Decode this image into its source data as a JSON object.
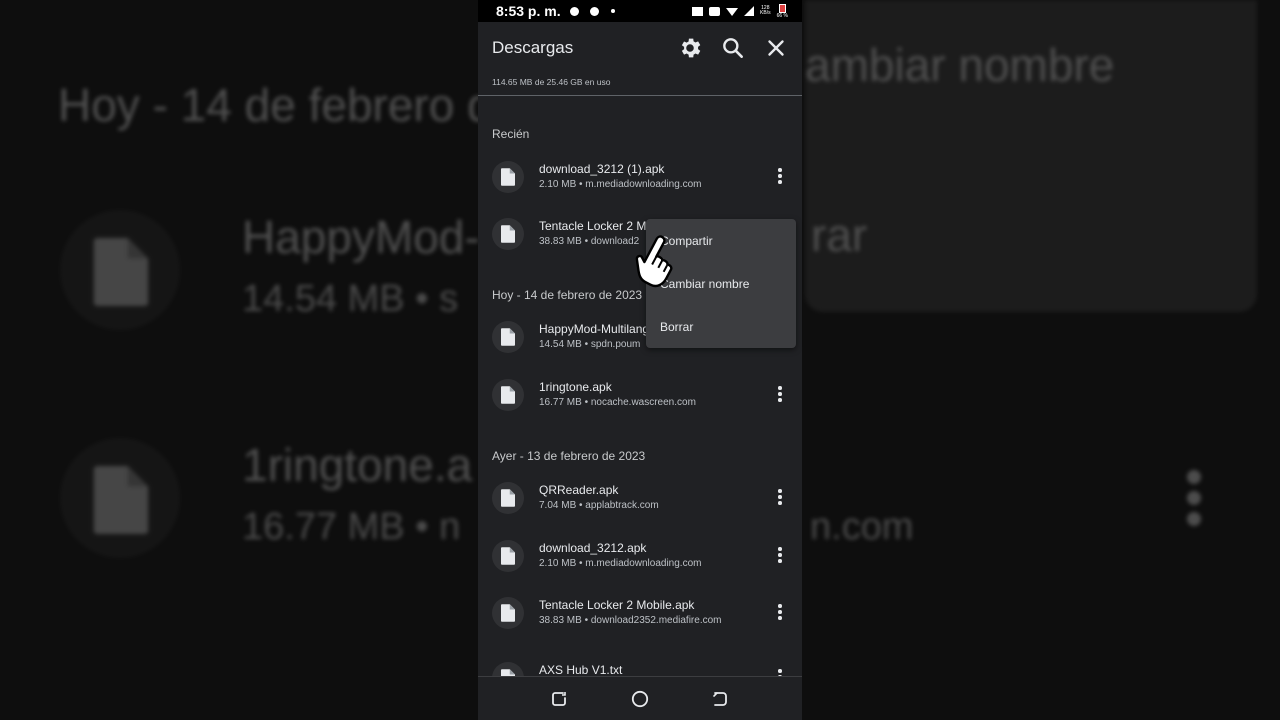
{
  "status_bar": {
    "time": "8:53 p. m.",
    "net_speed": "128",
    "net_unit": "KB/s",
    "battery": "66 %"
  },
  "app_bar": {
    "title": "Descargas",
    "settings_icon": "gear-icon",
    "search_icon": "search-icon",
    "close_icon": "close-icon"
  },
  "storage": {
    "text": "114.65 MB de 25.46 GB en uso"
  },
  "sections": [
    {
      "title": "Recién",
      "items": [
        {
          "name": "download_3212 (1).apk",
          "meta": "2.10 MB • m.mediadownloading.com"
        },
        {
          "name": "Tentacle Locker 2 M",
          "meta": "38.83 MB • download2"
        }
      ]
    },
    {
      "title": "Hoy - 14 de febrero de 2023",
      "items": [
        {
          "name": "HappyMod-Multilang",
          "meta": "14.54 MB • spdn.poum"
        },
        {
          "name": "1ringtone.apk",
          "meta": "16.77 MB • nocache.wascreen.com"
        }
      ]
    },
    {
      "title": "Ayer - 13 de febrero de 2023",
      "items": [
        {
          "name": "QRReader.apk",
          "meta": "7.04 MB • applabtrack.com"
        },
        {
          "name": "download_3212.apk",
          "meta": "2.10 MB • m.mediadownloading.com"
        },
        {
          "name": "Tentacle Locker 2 Mobile.apk",
          "meta": "38.83 MB • download2352.mediafire.com"
        },
        {
          "name": "AXS Hub V1.txt",
          "meta": ""
        }
      ]
    }
  ],
  "context_menu": {
    "items": [
      "Compartir",
      "Cambiar nombre",
      "Borrar"
    ]
  },
  "background": {
    "heading": "Hoy - 14 de febrero d",
    "menu_text": "ambiar nombre",
    "right_fragment": "rar",
    "file1_name": "HappyMod-",
    "file1_meta": "14.54 MB • s",
    "file2_name": "1ringtone.a",
    "file2_meta": "16.77 MB • n",
    "file2_meta_right": "n.com"
  },
  "colors": {
    "app_background": "#202124",
    "menu_background": "#3c3d40",
    "text_primary": "#e8eaed",
    "text_secondary": "#bdc1c6"
  }
}
